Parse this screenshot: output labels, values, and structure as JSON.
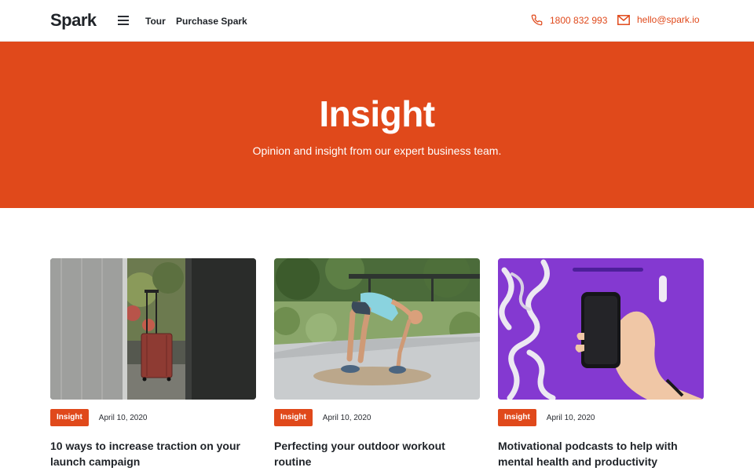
{
  "header": {
    "logo": "Spark",
    "nav": {
      "tour": "Tour",
      "purchase": "Purchase Spark"
    },
    "phone": "1800 832 993",
    "email": "hello@spark.io"
  },
  "hero": {
    "title": "Insight",
    "subtitle": "Opinion and insight from our expert business team."
  },
  "colors": {
    "accent": "#e0491b",
    "text": "#1f2328"
  },
  "posts": [
    {
      "tag": "Insight",
      "date": "April 10, 2020",
      "title": "10 ways to increase traction on your launch campaign",
      "image": "suitcase-photo"
    },
    {
      "tag": "Insight",
      "date": "April 10, 2020",
      "title": "Perfecting your outdoor workout routine",
      "image": "workout-photo"
    },
    {
      "tag": "Insight",
      "date": "April 10, 2020",
      "title": "Motivational podcasts to help with mental health and productivity",
      "image": "phone-purple-photo"
    }
  ]
}
